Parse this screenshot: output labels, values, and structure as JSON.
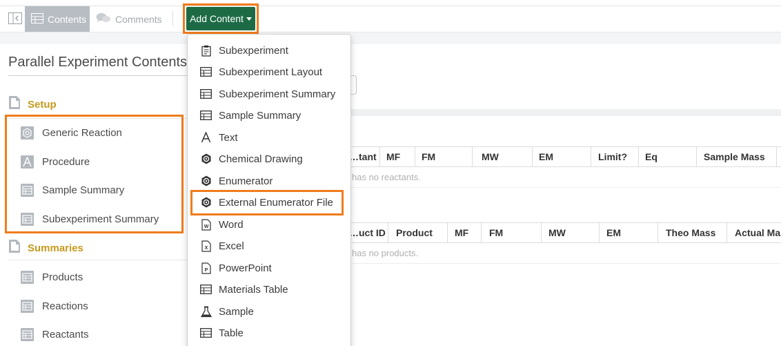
{
  "toolbar": {
    "contents_tab": "Contents",
    "comments_tab": "Comments",
    "add_content_label": "Add Content"
  },
  "page": {
    "title": "Parallel Experiment Contents"
  },
  "sections": [
    {
      "label": "Setup",
      "items": [
        {
          "label": "Generic Reaction",
          "icon": "reaction-icon"
        },
        {
          "label": "Procedure",
          "icon": "text-icon"
        },
        {
          "label": "Sample Summary",
          "icon": "table-icon"
        },
        {
          "label": "Subexperiment Summary",
          "icon": "table-icon"
        }
      ]
    },
    {
      "label": "Summaries",
      "items": [
        {
          "label": "Products",
          "icon": "table-icon"
        },
        {
          "label": "Reactions",
          "icon": "table-icon"
        },
        {
          "label": "Reactants",
          "icon": "table-icon"
        }
      ]
    }
  ],
  "background": {
    "reactants_headers": [
      "…tant",
      "MF",
      "FM",
      "MW",
      "EM",
      "Limit?",
      "Eq",
      "Sample Mass"
    ],
    "reactants_empty": "has no reactants.",
    "products_headers": [
      "…uct ID",
      "Product",
      "MF",
      "FM",
      "MW",
      "EM",
      "Theo Mass",
      "Actual Ma"
    ],
    "products_empty": "has no products."
  },
  "menu": {
    "items": [
      {
        "label": "Subexperiment",
        "icon": "clipboard-icon"
      },
      {
        "label": "Subexperiment Layout",
        "icon": "table-icon"
      },
      {
        "label": "Subexperiment Summary",
        "icon": "table-icon"
      },
      {
        "label": "Sample Summary",
        "icon": "table-icon"
      },
      {
        "label": "Text",
        "icon": "text-icon"
      },
      {
        "label": "Chemical Drawing",
        "icon": "molecule-icon"
      },
      {
        "label": "Enumerator",
        "icon": "molecule-icon"
      },
      {
        "label": "External Enumerator File",
        "icon": "molecule-icon"
      },
      {
        "label": "Word",
        "icon": "word-file-icon"
      },
      {
        "label": "Excel",
        "icon": "excel-file-icon"
      },
      {
        "label": "PowerPoint",
        "icon": "powerpoint-file-icon"
      },
      {
        "label": "Materials Table",
        "icon": "table-icon"
      },
      {
        "label": "Sample",
        "icon": "flask-icon"
      },
      {
        "label": "Table",
        "icon": "table-icon"
      }
    ]
  },
  "colors": {
    "accent_green": "#1d6b45",
    "highlight_orange": "#f07c1b",
    "section_gold": "#c49a1d"
  }
}
